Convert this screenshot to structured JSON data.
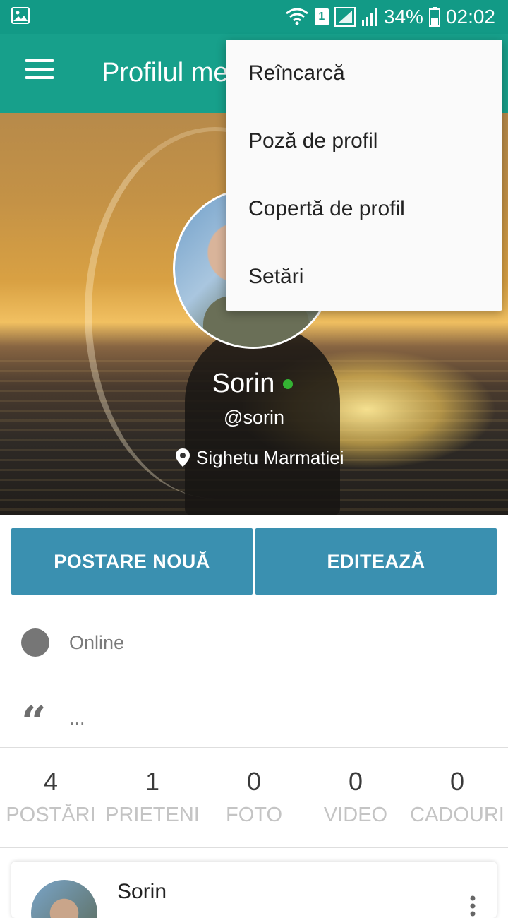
{
  "status_bar": {
    "battery_percent": "34%",
    "time": "02:02",
    "sim_number": "1",
    "icons": [
      "gallery-icon",
      "wifi-icon",
      "sim-icon",
      "signal-icon",
      "signal-icon",
      "battery-icon"
    ]
  },
  "app_bar": {
    "title": "Profilul meu",
    "menu_icon": "hamburger-icon"
  },
  "overflow_menu": {
    "items": [
      {
        "label": "Reîncarcă"
      },
      {
        "label": "Poză de profil"
      },
      {
        "label": "Copertă de profil"
      },
      {
        "label": "Setări"
      }
    ]
  },
  "profile": {
    "name": "Sorin",
    "username": "@sorin",
    "location": "Sighetu Marmatiei",
    "online_color": "#34b233"
  },
  "actions": {
    "new_post_label": "POSTARE NOUĂ",
    "edit_label": "EDITEAZĂ"
  },
  "info": {
    "status": "Online",
    "bio": "..."
  },
  "stats": [
    {
      "count": "4",
      "label": "POSTĂRI"
    },
    {
      "count": "1",
      "label": "PRIETENI"
    },
    {
      "count": "0",
      "label": "FOTO"
    },
    {
      "count": "0",
      "label": "VIDEO"
    },
    {
      "count": "0",
      "label": "CADOURI"
    }
  ],
  "post_preview": {
    "author": "Sorin"
  },
  "colors": {
    "primary": "#17a08b",
    "status_bar": "#129a86",
    "button": "#3a90b0"
  }
}
